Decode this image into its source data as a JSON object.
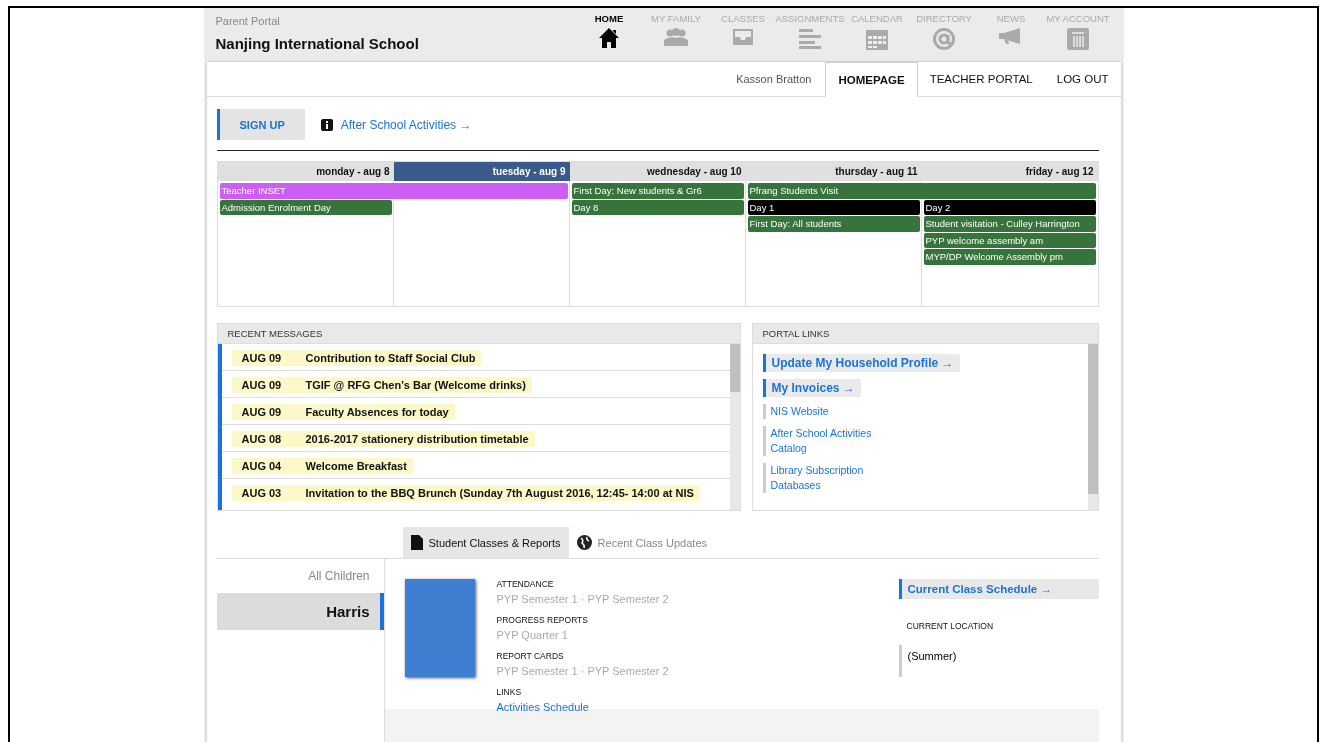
{
  "header": {
    "portal_label": "Parent Portal",
    "school": "Nanjing International School"
  },
  "nav": [
    {
      "label": "HOME",
      "selected": true
    },
    {
      "label": "MY FAMILY",
      "selected": false
    },
    {
      "label": "CLASSES",
      "selected": false
    },
    {
      "label": "ASSIGNMENTS",
      "selected": false
    },
    {
      "label": "CALENDAR",
      "selected": false
    },
    {
      "label": "DIRECTORY",
      "selected": false
    },
    {
      "label": "NEWS",
      "selected": false
    },
    {
      "label": "MY ACCOUNT",
      "selected": false
    }
  ],
  "user_name": "Kasson Bratton",
  "tabs": [
    {
      "label": "HOMEPAGE",
      "selected": true
    },
    {
      "label": "TEACHER PORTAL",
      "selected": false
    },
    {
      "label": "LOG OUT",
      "selected": false
    }
  ],
  "signup": {
    "button": "SIGN UP",
    "link": "After School Activities →"
  },
  "calendar": {
    "days": [
      {
        "label": "monday - aug 8",
        "selected": false
      },
      {
        "label": "tuesday - aug 9",
        "selected": true
      },
      {
        "label": "wednesday - aug 10",
        "selected": false
      },
      {
        "label": "thursday - aug 11",
        "selected": false
      },
      {
        "label": "friday - aug 12",
        "selected": false
      }
    ],
    "lanes": [
      [
        {
          "kind": "event",
          "text": "Teacher INSET",
          "color": "#cc5ef5"
        },
        {
          "kind": "continued"
        },
        {
          "kind": "event",
          "text": "First Day: New students & Gr6",
          "color": "#36743c"
        },
        {
          "kind": "event",
          "text": "Pfrang Students Visit",
          "color": "#36743c"
        },
        {
          "kind": "continued"
        }
      ],
      [
        {
          "kind": "event",
          "text": "Admission Enrolment Day",
          "color": "#36743c"
        },
        {
          "kind": "empty"
        },
        {
          "kind": "event",
          "text": "Day 8",
          "color": "#36743c"
        },
        {
          "kind": "event",
          "text": "Day 1",
          "color": "#000000"
        },
        {
          "kind": "event",
          "text": "Day 2",
          "color": "#000000"
        }
      ],
      [
        {
          "kind": "empty"
        },
        {
          "kind": "empty"
        },
        {
          "kind": "empty"
        },
        {
          "kind": "event",
          "text": "First Day: All students",
          "color": "#36743c"
        },
        {
          "kind": "event",
          "text": "Student visitation - Culley Harrington",
          "color": "#36743c"
        }
      ],
      [
        {
          "kind": "empty"
        },
        {
          "kind": "empty"
        },
        {
          "kind": "empty"
        },
        {
          "kind": "empty"
        },
        {
          "kind": "event",
          "text": "PYP welcome assembly am",
          "color": "#36743c"
        }
      ],
      [
        {
          "kind": "empty"
        },
        {
          "kind": "empty"
        },
        {
          "kind": "empty"
        },
        {
          "kind": "empty"
        },
        {
          "kind": "event",
          "text": "MYP/DP Welcome Assembly pm",
          "color": "#36743c"
        }
      ]
    ]
  },
  "recent_messages": {
    "title": "RECENT MESSAGES",
    "items": [
      {
        "date": "AUG 09",
        "title": "Contribution to Staff Social Club"
      },
      {
        "date": "AUG 09",
        "title": "TGIF @ RFG Chen's Bar (Welcome drinks)"
      },
      {
        "date": "AUG 09",
        "title": "Faculty Absences for today"
      },
      {
        "date": "AUG 08",
        "title": "2016-2017 stationery distribution timetable"
      },
      {
        "date": "AUG 04",
        "title": "Welcome Breakfast"
      },
      {
        "date": "AUG 03",
        "title": "Invitation to the BBQ Brunch (Sunday 7th August 2016, 12:45- 14:00 at NIS"
      }
    ]
  },
  "portal_links": {
    "title": "PORTAL LINKS",
    "items": [
      {
        "kind": "primary",
        "text": "Update My Household Profile →"
      },
      {
        "kind": "primary",
        "text": "My Invoices →"
      },
      {
        "kind": "secondary",
        "text": "NIS Website"
      },
      {
        "kind": "secondary",
        "text": "After School Activities Catalog"
      },
      {
        "kind": "secondary",
        "text": "Library Subscription Databases"
      }
    ]
  },
  "student_tabs": [
    {
      "label": "Student Classes & Reports",
      "selected": true
    },
    {
      "label": "Recent Class Updates",
      "selected": false
    }
  ],
  "children": [
    {
      "name": "All Children",
      "selected": false
    },
    {
      "name": "Harris",
      "selected": true
    }
  ],
  "reports": [
    {
      "heading": "ATTENDANCE",
      "value": "PYP Semester 1 · PYP Semester 2",
      "kind": "text"
    },
    {
      "heading": "PROGRESS REPORTS",
      "value": "PYP Quarter 1",
      "kind": "text"
    },
    {
      "heading": "REPORT CARDS",
      "value": "PYP Semester 1 · PYP Semester 2",
      "kind": "text"
    },
    {
      "heading": "LINKS",
      "value": "Activities Schedule",
      "kind": "link"
    }
  ],
  "schedule_link": "Current Class Schedule →",
  "location": {
    "heading": "CURRENT LOCATION",
    "value": "(Summer)"
  }
}
